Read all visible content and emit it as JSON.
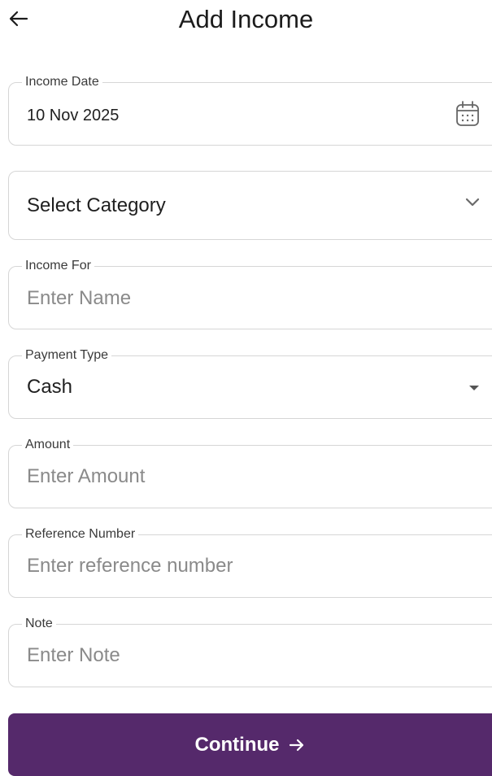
{
  "header": {
    "title": "Add Income",
    "back_icon": "arrow-left-icon"
  },
  "form": {
    "income_date": {
      "label": "Income Date",
      "value": "10 Nov 2025",
      "icon": "calendar-icon"
    },
    "category": {
      "placeholder": "Select Category",
      "icon": "chevron-down-icon"
    },
    "income_for": {
      "label": "Income For",
      "placeholder": "Enter Name"
    },
    "payment_type": {
      "label": "Payment Type",
      "value": "Cash",
      "icon": "caret-down-icon"
    },
    "amount": {
      "label": "Amount",
      "placeholder": "Enter Amount"
    },
    "reference_number": {
      "label": "Reference Number",
      "placeholder": "Enter reference number"
    },
    "note": {
      "label": "Note",
      "placeholder": "Enter Note"
    }
  },
  "actions": {
    "continue_label": "Continue",
    "continue_icon": "arrow-right-icon"
  },
  "colors": {
    "primary": "#55296b",
    "border": "#d6d6d6",
    "placeholder": "#8a8a8a"
  }
}
